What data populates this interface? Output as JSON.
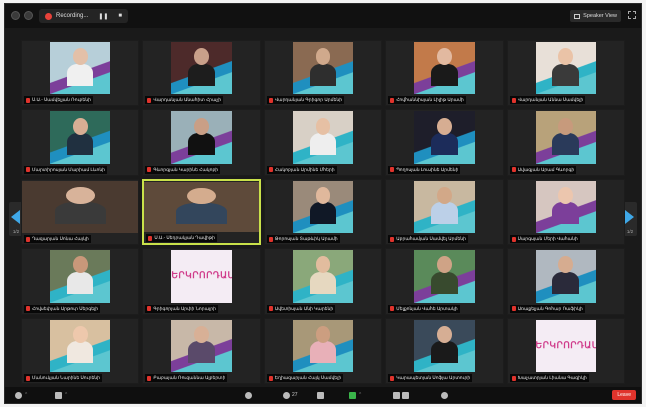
{
  "topbar": {
    "recording_label": "Recording...",
    "recording_pause": "❚❚",
    "recording_stop": "■",
    "speaker_view_label": "Speaker View"
  },
  "colors": {
    "background": "#1a1a1a",
    "active_border": "#c9e14a",
    "mic_muted": "#e0332c",
    "arrow_accent": "#3fa8e8",
    "end_button": "#e0332c"
  },
  "nav": {
    "left_page": "1/2",
    "right_page": "1/2"
  },
  "logo_text": "ԵՐԿՐՈՐԴԱՄԻ",
  "tiles": [
    {
      "name": "Ս.Ա.- Սամվելյան Ռուբենի",
      "kind": "card",
      "bg": "#b7cfd9",
      "skin": "#e3c0a8",
      "cloth": "#f0f0f0",
      "pattern": "#7c3f9a"
    },
    {
      "name": "Վարդանյան Անահիտ Հրաչի",
      "kind": "card",
      "bg": "#4d2a2a",
      "skin": "#c9a08a",
      "cloth": "#1d1d1d",
      "pattern": "#1f8fbf"
    },
    {
      "name": "Վարդանյան Գրիգոր Արմենի",
      "kind": "card",
      "bg": "#8a6a52",
      "skin": "#d0a98c",
      "cloth": "#2e2e2e",
      "pattern": "#1f8fbf"
    },
    {
      "name": "Հովհաննիսյան Լիլիթ Արամի",
      "kind": "card",
      "bg": "#c27a4a",
      "skin": "#e2b9a0",
      "cloth": "#1a1a1a",
      "pattern": "#7c3f9a"
    },
    {
      "name": "Վարդանյան Աննա Սամվելի",
      "kind": "card",
      "bg": "#e8e0d8",
      "skin": "#eac3a7",
      "cloth": "#3a3a3a",
      "pattern": "#2fb3c6"
    },
    {
      "name": "Մարտիրոսյան Մարիամ Լևոնի",
      "kind": "card",
      "bg": "#2e6a5a",
      "skin": "#d8ae94",
      "cloth": "#203040",
      "pattern": "#1f8fbf"
    },
    {
      "name": "Գևորգյան Կարինե Հակոբի",
      "kind": "card",
      "bg": "#9ab0b8",
      "skin": "#c99f86",
      "cloth": "#111",
      "pattern": "#7c3f9a"
    },
    {
      "name": "Հակոբյան Արմինե Մհերի",
      "kind": "card",
      "bg": "#d8d0c6",
      "skin": "#e6c0a4",
      "cloth": "#eeeeee",
      "pattern": "#2fb3c6"
    },
    {
      "name": "Պողոսյան Լուսինե Արմենի",
      "kind": "card",
      "bg": "#1e1e2a",
      "skin": "#d6ad92",
      "cloth": "#1c2c5a",
      "pattern": "#1f8fbf"
    },
    {
      "name": "Ավագյան Արամ Գևորգի",
      "kind": "card",
      "bg": "#b8a27a",
      "skin": "#c79a7c",
      "cloth": "#2a3a5a",
      "pattern": "#7c3f9a"
    },
    {
      "name": "Ղազարյան Սոնա Հայկի",
      "kind": "full",
      "bg": "#4a3a30",
      "skin": "#d8b39a",
      "cloth": "#3a3a3a",
      "pattern": "#4a3a30"
    },
    {
      "name": "Ս.Ա.- Սեդրակյան Դավիթի",
      "kind": "full",
      "bg": "#5e4a3a",
      "skin": "#d4ac8e",
      "cloth": "#33465c",
      "pattern": "#5e4a3a"
    },
    {
      "name": "Թորոսյան Տաթևիկ Արամի",
      "kind": "card",
      "bg": "#9a8a7a",
      "skin": "#e0b89c",
      "cloth": "#101826",
      "pattern": "#1f8fbf"
    },
    {
      "name": "Աբրահամյան Սամվել Արմենի",
      "kind": "card",
      "bg": "#c8b8a0",
      "skin": "#d2a888",
      "cloth": "#bcd0e8",
      "pattern": "#2fb3c6"
    },
    {
      "name": "Սարգսյան Մերի Վահանի",
      "kind": "card",
      "bg": "#d6c6c0",
      "skin": "#ecc6ae",
      "cloth": "#7c3f9a",
      "pattern": "#7c3f9a"
    },
    {
      "name": "Հովսեփյան Արթուր Սերգեյի",
      "kind": "card",
      "bg": "#6a7a5a",
      "skin": "#c8987a",
      "cloth": "#e8e8e8",
      "pattern": "#2fb3c6"
    },
    {
      "name": "Գրիգորյան Արփի Նորայրի",
      "kind": "logo",
      "bg": "#f4ecf4",
      "skin": "",
      "cloth": "",
      "pattern": "#d03c8b"
    },
    {
      "name": "Ավետիսյան Անի Կարենի",
      "kind": "card",
      "bg": "#8aa87a",
      "skin": "#e2bc9e",
      "cloth": "#e6d8c0",
      "pattern": "#2fb3c6"
    },
    {
      "name": "Մելքոնյան Վահե Արտակի",
      "kind": "card",
      "bg": "#5a8a5a",
      "skin": "#cfa386",
      "cloth": "#384a2e",
      "pattern": "#7c3f9a"
    },
    {
      "name": "Առաքելյան Գոհար Ռաֆիկի",
      "kind": "card",
      "bg": "#b0b8c0",
      "skin": "#d6ac90",
      "cloth": "#2a2a3a",
      "pattern": "#1f8fbf"
    },
    {
      "name": "Մանուկյան Նարինե Սուրենի",
      "kind": "card",
      "bg": "#d8c0a0",
      "skin": "#eec8ac",
      "cloth": "#f0e8e0",
      "pattern": "#2fb3c6"
    },
    {
      "name": "Բաբայան Ռուզաննա Ալբերտի",
      "kind": "card",
      "bg": "#c8b8a8",
      "skin": "#d8b096",
      "cloth": "#5a4a6a",
      "pattern": "#7c3f9a"
    },
    {
      "name": "Եղիազարյան Հայկ Սամվելի",
      "kind": "card",
      "bg": "#a89878",
      "skin": "#cc9e80",
      "cloth": "#e8b0b8",
      "pattern": "#1f8fbf"
    },
    {
      "name": "Կարապետյան Սոֆյա Արտուրի",
      "kind": "card",
      "bg": "#3a4a5a",
      "skin": "#d6ae94",
      "cloth": "#1a1a1a",
      "pattern": "#2fb3c6"
    },
    {
      "name": "Խաչատրյան Լիանա Գագիկի",
      "kind": "logo",
      "bg": "#f4ecf4",
      "skin": "",
      "cloth": "",
      "pattern": "#d03c8b"
    }
  ],
  "toolbar": {
    "participants_count": "27",
    "end_label": "Leave"
  }
}
